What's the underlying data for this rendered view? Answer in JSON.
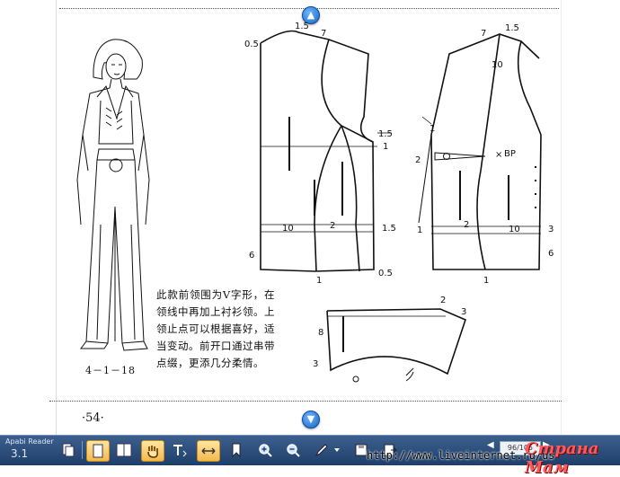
{
  "reader": {
    "app_name": "Apabi Reader",
    "app_version": "3.1",
    "page_indicator": "96/105",
    "url_overlay": "http://www.liveinternet.ru/us",
    "watermark": "Страна Мам"
  },
  "page": {
    "figure_label": "4－1－18",
    "caption": "此款前领围为V字形，在领线中再加上衬衫领。上领止点可以根据喜好，适当变动。前开口通过串带点缀，更添几分柔情。",
    "page_number": "·54·"
  },
  "pattern_labels": {
    "front_top_left": "0.5",
    "front_top_mid": "1.5",
    "front_top_right": "7",
    "front_side_shift": "1.5",
    "front_side_one": "1",
    "front_waist_10": "10",
    "front_waist_2": "2",
    "front_waist_15": "1.5",
    "front_hem_6": "6",
    "front_hem_05": "0.5",
    "front_hem_1": "1",
    "back_top_7": "7",
    "back_top_15": "1.5",
    "back_neck_10": "10",
    "back_side_1": "1",
    "back_dart_2": "2",
    "back_bp": "BP",
    "back_waist_1": "1",
    "back_waist_2": "2",
    "back_waist_10": "10",
    "back_waist_3": "3",
    "back_hem_6": "6",
    "back_hem_1": "1",
    "collar_2": "2",
    "collar_3_top": "3",
    "collar_8": "8",
    "collar_3_bottom": "3"
  }
}
